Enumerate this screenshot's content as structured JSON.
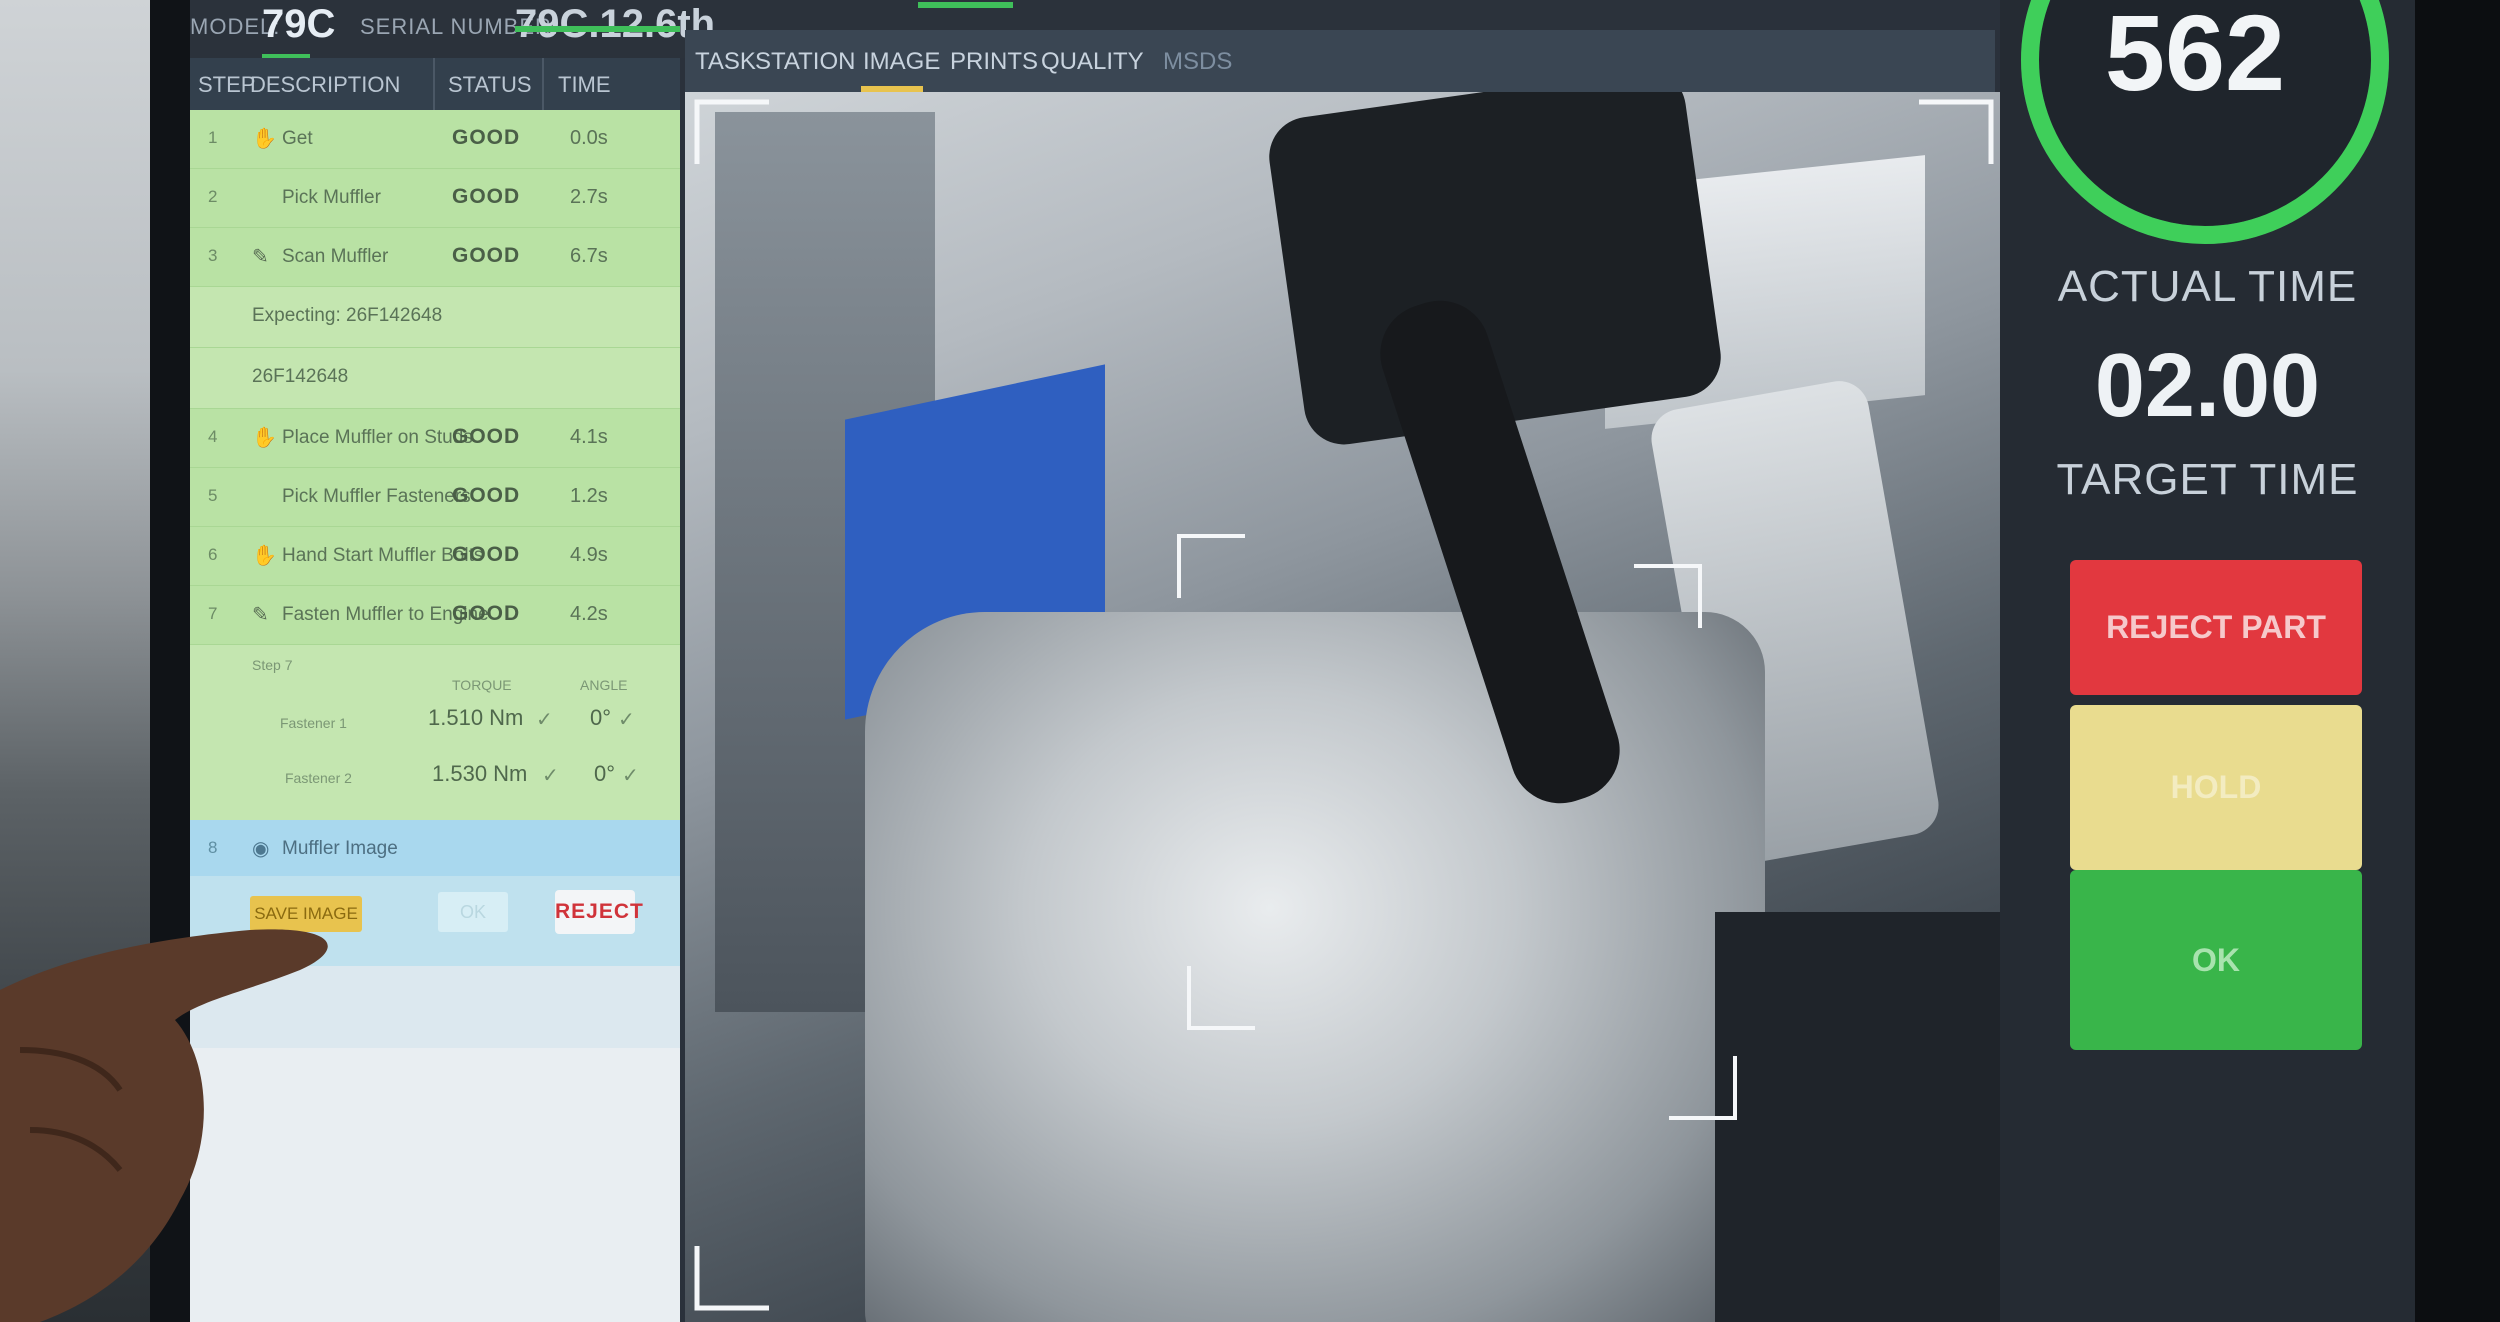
{
  "header": {
    "model_label": "MODEL:",
    "model_value": "79C",
    "serial_label": "SERIAL NUMBER:",
    "serial_value": "79C.12.6th"
  },
  "task_panel": {
    "columns": [
      "STEP",
      "DESCRIPTION",
      "STATUS",
      "TIME"
    ],
    "steps": [
      {
        "num": "1",
        "icon": "hand-icon",
        "desc": "Get",
        "status": "GOOD",
        "time": "0.0s"
      },
      {
        "num": "2",
        "icon": "",
        "desc": "Pick Muffler",
        "status": "GOOD",
        "time": "2.7s"
      },
      {
        "num": "3",
        "icon": "pen-icon",
        "desc": "Scan Muffler",
        "status": "GOOD",
        "time": "6.7s"
      }
    ],
    "scan_lines": [
      "Expecting: 26F142648",
      "26F142648"
    ],
    "steps_b": [
      {
        "num": "4",
        "icon": "hand-icon",
        "desc": "Place Muffler on Studs",
        "status": "GOOD",
        "time": "4.1s"
      },
      {
        "num": "5",
        "icon": "",
        "desc": "Pick Muffler Fasteners",
        "status": "GOOD",
        "time": "1.2s"
      },
      {
        "num": "6",
        "icon": "hand-icon",
        "desc": "Hand Start Muffler Bolts",
        "status": "GOOD",
        "time": "4.9s"
      },
      {
        "num": "7",
        "icon": "pen-icon",
        "desc": "Fasten Muffler to Engine",
        "status": "GOOD",
        "time": "4.2s"
      }
    ],
    "torque": {
      "step_label": "Step 7",
      "torque_col": "TORQUE",
      "angle_col": "ANGLE",
      "rows": [
        {
          "label": "Fastener 1",
          "torque": "1.510 Nm",
          "angle": "0°"
        },
        {
          "label": "Fastener 2",
          "torque": "1.530 Nm",
          "angle": "0°"
        }
      ]
    },
    "photo_step": {
      "num": "8",
      "desc": "Muffler Image"
    },
    "save_label": "SAVE IMAGE",
    "ok_label": "OK",
    "reject_label": "REJECT"
  },
  "tabs": [
    {
      "label": "TASK",
      "active": false
    },
    {
      "label": "STATION",
      "active": false
    },
    {
      "label": "IMAGE",
      "active": true
    },
    {
      "label": "PRINTS",
      "active": false
    },
    {
      "label": "QUALITY",
      "active": false
    },
    {
      "label": "MSDS",
      "active": false
    }
  ],
  "right_panel": {
    "counter": "562",
    "actual_time_label": "ACTUAL TIME",
    "target_time_value": "02.00",
    "target_time_label": "TARGET TIME",
    "reject_label": "REJECT PART",
    "hold_label": "HOLD",
    "ok_label": "OK",
    "gauge_progress": 0.82
  },
  "colors": {
    "good_row": "#b9e2a4",
    "accent_yellow": "#e8c34e",
    "gauge_green": "#3fcf5a",
    "reject_red": "#e2383f",
    "hold_yellow": "#e9dc8f",
    "ok_green": "#39b54a"
  }
}
